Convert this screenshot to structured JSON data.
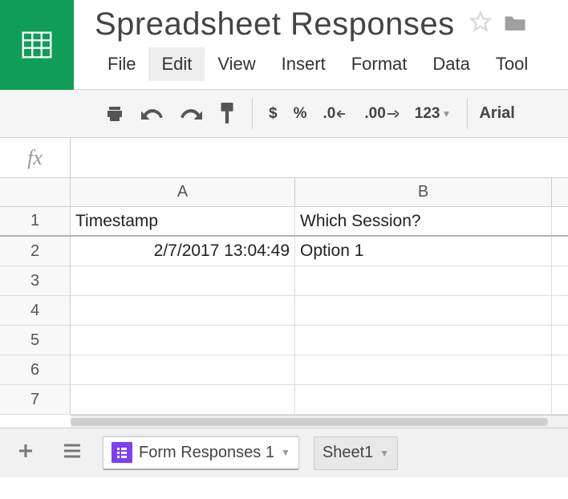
{
  "doc_title": "Spreadsheet Responses",
  "menus": [
    "File",
    "Edit",
    "View",
    "Insert",
    "Format",
    "Data",
    "Tool"
  ],
  "active_menu_index": 1,
  "toolbar": {
    "dollar": "$",
    "percent": "%",
    "dec_decrease": ".0",
    "dec_increase": ".00",
    "num_format": "123",
    "font": "Arial"
  },
  "formula_bar_value": "",
  "columns": [
    "A",
    "B"
  ],
  "rows": [
    {
      "num": "1",
      "a": "Timestamp",
      "b": "Which Session?",
      "header": true
    },
    {
      "num": "2",
      "a": "2/7/2017 13:04:49",
      "b": "Option 1",
      "a_align": "right"
    },
    {
      "num": "3",
      "a": "",
      "b": ""
    },
    {
      "num": "4",
      "a": "",
      "b": ""
    },
    {
      "num": "5",
      "a": "",
      "b": ""
    },
    {
      "num": "6",
      "a": "",
      "b": ""
    },
    {
      "num": "7",
      "a": "",
      "b": ""
    }
  ],
  "sheets": {
    "active": "Form Responses 1",
    "other": "Sheet1"
  }
}
